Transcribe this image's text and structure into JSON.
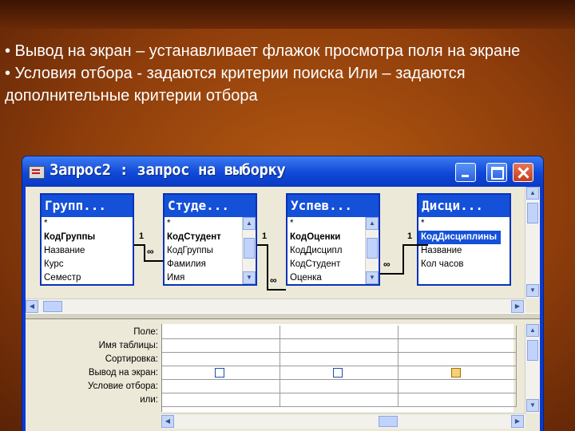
{
  "slide": {
    "bullet1": "• Вывод на экран – устанавливает флажок просмотра поля на экране",
    "bullet2": "• Условия отбора  - задаются критерии поиска Или – задаются дополнительные критерии отбора"
  },
  "window": {
    "title": "Запрос2 : запрос на выборку"
  },
  "tables": [
    {
      "name": "Групп...",
      "fields": [
        "*",
        "КодГруппы",
        "Название",
        "Курс",
        "Семестр"
      ]
    },
    {
      "name": "Студе...",
      "fields": [
        "*",
        "КодСтудент",
        "КодГруппы",
        "Фамилия",
        "Имя"
      ]
    },
    {
      "name": "Успев...",
      "fields": [
        "*",
        "КодОценки",
        "КодДисципл",
        "КодСтудент",
        "Оценка"
      ]
    },
    {
      "name": "Дисци...",
      "fields": [
        "*",
        "КодДисциплины",
        "Название",
        "Кол часов"
      ]
    }
  ],
  "relations": {
    "one": "1",
    "many": "∞"
  },
  "grid": {
    "row_labels": [
      "Поле:",
      "Имя таблицы:",
      "Сортировка:",
      "Вывод на экран:",
      "Условие отбора:",
      "или:"
    ]
  },
  "colors": {
    "title_blue": "#1048d8",
    "background": "#8e3d0b",
    "client": "#ece9d8"
  }
}
